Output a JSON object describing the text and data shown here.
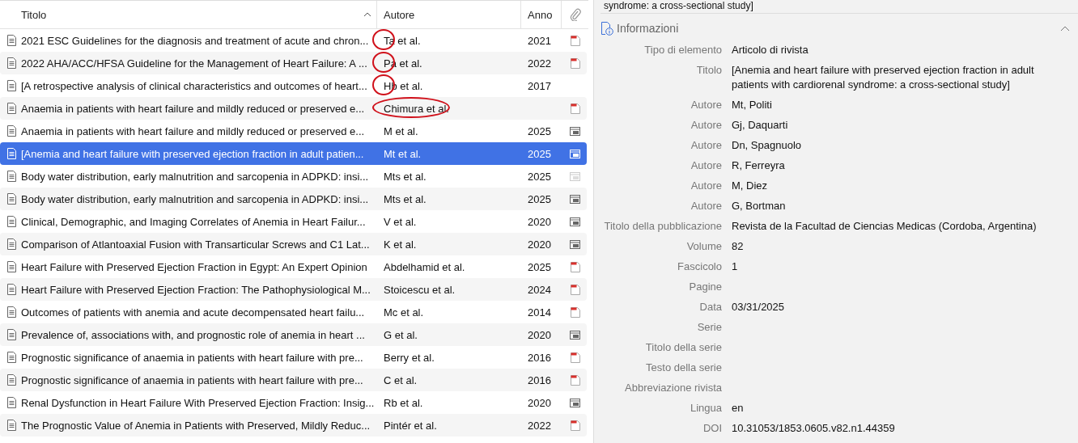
{
  "table": {
    "columns": [
      {
        "label": "Titolo",
        "sorted_ascending": true
      },
      {
        "label": "Autore"
      },
      {
        "label": "Anno"
      },
      {
        "kind": "attachment"
      }
    ],
    "rows": [
      {
        "title": "2021 ESC Guidelines for the diagnosis and treatment of acute and chron...",
        "author": "Ta et al.",
        "year": "2021",
        "attachment": {
          "kind": "pdf"
        },
        "selected": false,
        "circled": true
      },
      {
        "title": "2022 AHA/ACC/HFSA Guideline for the Management of Heart Failure: A ...",
        "author": "Pa et al.",
        "year": "2022",
        "attachment": {
          "kind": "pdf"
        },
        "selected": false,
        "circled": true
      },
      {
        "title": "[A retrospective analysis of clinical characteristics and outcomes of heart...",
        "author": "Hb et al.",
        "year": "2017",
        "selected": false,
        "circled": true
      },
      {
        "title": "Anaemia in patients with heart failure and mildly reduced or preserved e...",
        "author": "Chimura et al.",
        "attachment": {
          "kind": "pdf"
        },
        "selected": false,
        "circled": true
      },
      {
        "title": "Anaemia in patients with heart failure and mildly reduced or preserved e...",
        "author": "M et al.",
        "year": "2025",
        "attachment": {
          "kind": "snapshot"
        },
        "selected": false,
        "circled": false
      },
      {
        "title": "[Anemia and heart failure with preserved ejection fraction in adult patien...",
        "author": "Mt et al.",
        "year": "2025",
        "attachment": {
          "kind": "snapshot"
        },
        "selected": true,
        "circled": false
      },
      {
        "title": "Body water distribution, early malnutrition and sarcopenia in ADPKD: insi...",
        "author": "Mts et al.",
        "year": "2025",
        "attachment": {
          "kind": "snapshot-missing"
        },
        "selected": false,
        "circled": false
      },
      {
        "title": "Body water distribution, early malnutrition and sarcopenia in ADPKD: insi...",
        "author": "Mts et al.",
        "year": "2025",
        "attachment": {
          "kind": "snapshot"
        },
        "selected": false,
        "circled": false
      },
      {
        "title": "Clinical, Demographic, and Imaging Correlates of Anemia in Heart Failur...",
        "author": "V et al.",
        "year": "2020",
        "attachment": {
          "kind": "snapshot"
        },
        "selected": false,
        "circled": false
      },
      {
        "title": "Comparison of Atlantoaxial Fusion with Transarticular Screws and C1 Lat...",
        "author": "K et al.",
        "year": "2020",
        "attachment": {
          "kind": "snapshot"
        },
        "selected": false,
        "circled": false
      },
      {
        "title": "Heart Failure with Preserved Ejection Fraction in Egypt: An Expert Opinion",
        "author": "Abdelhamid et al.",
        "year": "2025",
        "attachment": {
          "kind": "pdf"
        },
        "selected": false,
        "circled": false
      },
      {
        "title": "Heart Failure with Preserved Ejection Fraction: The Pathophysiological M...",
        "author": "Stoicescu et al.",
        "year": "2024",
        "attachment": {
          "kind": "pdf"
        },
        "selected": false,
        "circled": false
      },
      {
        "title": "Outcomes of patients with anemia and acute decompensated heart failu...",
        "author": "Mc et al.",
        "year": "2014",
        "attachment": {
          "kind": "pdf"
        },
        "selected": false,
        "circled": false
      },
      {
        "title": "Prevalence of, associations with, and prognostic role of anemia in heart ...",
        "author": "G et al.",
        "year": "2020",
        "attachment": {
          "kind": "snapshot"
        },
        "selected": false,
        "circled": false
      },
      {
        "title": "Prognostic significance of anaemia in patients with heart failure with pre...",
        "author": "Berry et al.",
        "year": "2016",
        "attachment": {
          "kind": "pdf"
        },
        "selected": false,
        "circled": false
      },
      {
        "title": "Prognostic significance of anaemia in patients with heart failure with pre...",
        "author": "C et al.",
        "year": "2016",
        "attachment": {
          "kind": "pdf"
        },
        "selected": false,
        "circled": false
      },
      {
        "title": "Renal Dysfunction in Heart Failure With Preserved Ejection Fraction: Insig...",
        "author": "Rb et al.",
        "year": "2020",
        "attachment": {
          "kind": "snapshot"
        },
        "selected": false,
        "circled": false
      },
      {
        "title": "The Prognostic Value of Anemia in Patients with Preserved, Mildly Reduc...",
        "author": "Pintér et al.",
        "year": "2022",
        "attachment": {
          "kind": "pdf"
        },
        "selected": false,
        "circled": false
      }
    ]
  },
  "item_pane": {
    "header_tail": "syndrome: a cross-sectional study]",
    "section": {
      "title": "Informazioni",
      "expanded": true
    },
    "fields": [
      {
        "label": "Tipo di elemento",
        "value": "Articolo di rivista"
      },
      {
        "label": "Titolo",
        "value": "[Anemia and heart failure with preserved ejection fraction in adult patients with cardiorenal syndrome: a cross-sectional study]"
      },
      {
        "label": "Autore",
        "value": "Mt, Politi"
      },
      {
        "label": "Autore",
        "value": "Gj, Daquarti"
      },
      {
        "label": "Autore",
        "value": "Dn, Spagnuolo"
      },
      {
        "label": "Autore",
        "value": "R, Ferreyra"
      },
      {
        "label": "Autore",
        "value": "M, Diez"
      },
      {
        "label": "Autore",
        "value": "G, Bortman"
      },
      {
        "label": "Titolo della pubblicazione",
        "value": "Revista de la Facultad de Ciencias Medicas (Cordoba, Argentina)"
      },
      {
        "label": "Volume",
        "value": "82"
      },
      {
        "label": "Fascicolo",
        "value": "1"
      },
      {
        "label": "Pagine"
      },
      {
        "label": "Data",
        "value": "03/31/2025"
      },
      {
        "label": "Serie"
      },
      {
        "label": "Titolo della serie"
      },
      {
        "label": "Testo della serie"
      },
      {
        "label": "Abbreviazione rivista"
      },
      {
        "label": "Lingua",
        "value": "en"
      },
      {
        "label": "DOI",
        "value": "10.31053/1853.0605.v82.n1.44359"
      }
    ]
  }
}
